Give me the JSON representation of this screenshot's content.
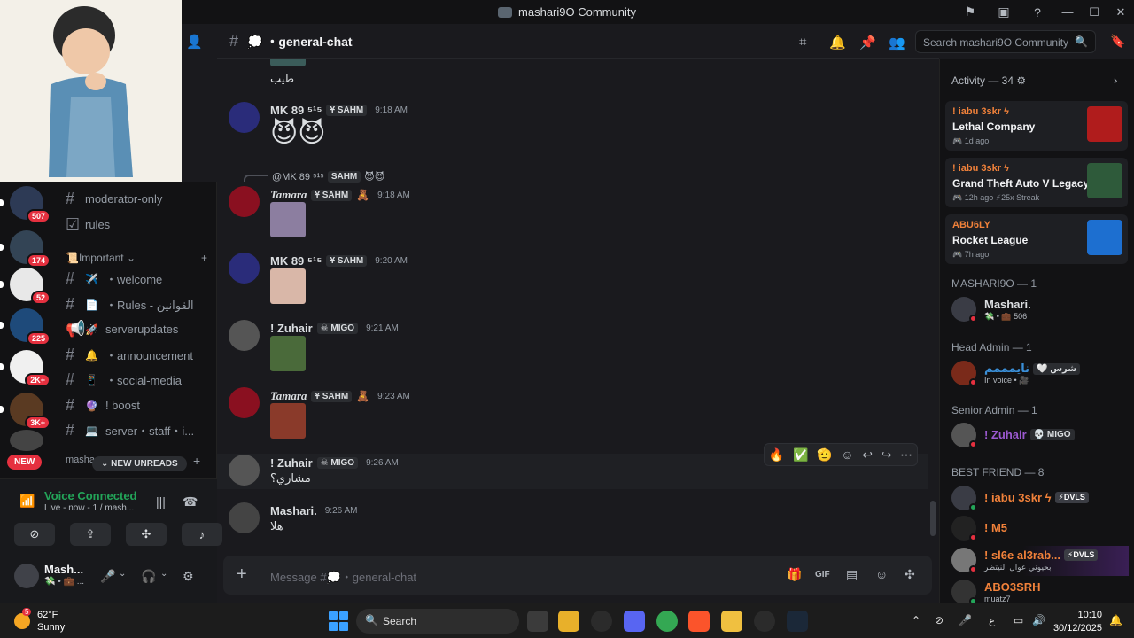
{
  "window": {
    "title": "mashari9O Community",
    "icons": [
      "flag-icon",
      "inbox-box-icon",
      "help-icon"
    ],
    "controls": [
      "—",
      "☐",
      "✕"
    ]
  },
  "rail": {
    "servers": [
      {
        "badge": "507",
        "color": "#2d3a55"
      },
      {
        "badge": "174",
        "color": "#334455"
      },
      {
        "badge": "52",
        "color": "#e8e8e8"
      },
      {
        "badge": "225",
        "color": "#1e4a7a"
      },
      {
        "badge": "2K+",
        "color": "#f0f0f0"
      },
      {
        "badge": "3K+",
        "color": "#5a3a22"
      },
      {
        "badge": "",
        "color": "#444"
      }
    ],
    "new_label": "NEW"
  },
  "channels": {
    "items_top": [
      {
        "name": "moderator-only",
        "icon": "#"
      },
      {
        "name": "rules",
        "icon": "☑"
      }
    ],
    "category": "Important",
    "category_prefix": "📜",
    "items": [
      {
        "name": "・welcome",
        "emoji": "✈️",
        "icon": "#"
      },
      {
        "name": "・Rules - القوانين",
        "emoji": "📄",
        "icon": "#"
      },
      {
        "name": "serverupdates",
        "emoji": "🚀",
        "icon": "📢"
      },
      {
        "name": "・announcement",
        "emoji": "🔔",
        "icon": "#"
      },
      {
        "name": "・social-media",
        "emoji": "📱",
        "icon": "#"
      },
      {
        "name": "! boost",
        "emoji": "🔮",
        "icon": "#"
      },
      {
        "name": "server・staff・i...",
        "emoji": "💻",
        "icon": "#"
      }
    ],
    "partial_category": "masha",
    "new_unreads": "NEW UNREADS"
  },
  "voice": {
    "title": "Voice Connected",
    "subtitle": "Live - now - 1 / mash..."
  },
  "user": {
    "name": "Mash...",
    "status": "💸 • 💼 ..."
  },
  "header": {
    "channel": "・general-chat",
    "channel_emoji": "💭",
    "search_placeholder": "Search mashari9O Community"
  },
  "messages": [
    {
      "body": "طيب"
    },
    {
      "author": "MK 89 ⁵¹⁵",
      "author_color": "#dbdee1",
      "tag": "SAHM",
      "time": "9:18 AM",
      "body": "😈😈"
    },
    {
      "reply_to": "@MK 89 ⁵¹⁵",
      "reply_tag": "SAHM",
      "reply_emoji": "😈😈",
      "author": "Tamara",
      "author_color": "#c0233a",
      "tag": "SAHM",
      "extra": "🧸",
      "time": "9:18 AM"
    },
    {
      "author": "MK 89 ⁵¹⁵",
      "author_color": "#dbdee1",
      "tag": "SAHM",
      "time": "9:20 AM"
    },
    {
      "author": "! Zuhair",
      "author_color": "#9b59d0",
      "tag": "MIGO",
      "time": "9:21 AM"
    },
    {
      "author": "Tamara",
      "author_color": "#c0233a",
      "tag": "SAHM",
      "extra": "🧸",
      "time": "9:23 AM"
    },
    {
      "author": "! Zuhair",
      "author_color": "#9b59d0",
      "tag": "MIGO",
      "time": "9:26 AM",
      "body": "مشاري؟"
    },
    {
      "author": "Mashari.",
      "author_color": "#dbdee1",
      "time": "9:26 AM",
      "body": "هلا"
    }
  ],
  "reactions": [
    "🔥",
    "✅",
    "🫡"
  ],
  "composer": {
    "placeholder": "Message #💭・general-chat"
  },
  "activity": {
    "header": "Activity — 34",
    "cards": [
      {
        "user": "! iabu 3skr ϟ",
        "game": "Lethal Company",
        "time": "1d ago",
        "color": "#b01c1c"
      },
      {
        "user": "! iabu 3skr ϟ",
        "game": "Grand Theft Auto V Legacy",
        "time": "12h ago",
        "streak": "25x Streak",
        "color": "#2e5a3a"
      },
      {
        "user": "ABU6LY",
        "game": "Rocket League",
        "time": "7h ago",
        "color": "#1d6fd0"
      }
    ]
  },
  "member_sections": [
    {
      "title": "MASHARI9O — 1",
      "members": [
        {
          "name": "Mashari.",
          "sub": "💸 • 💼 506",
          "color": "#dbdee1",
          "status": "#e5303f"
        }
      ]
    },
    {
      "title": "Head Admin — 1",
      "members": [
        {
          "name": "نايمممم",
          "badge": "🤍 شرس",
          "sub": "In voice • 🎥",
          "color": "#3a8fd8",
          "status": "#e5303f"
        }
      ]
    },
    {
      "title": "Senior Admin — 1",
      "members": [
        {
          "name": "! Zuhair",
          "badge": "💀 MIGO",
          "color": "#9b59d0",
          "status": "#e5303f"
        }
      ]
    },
    {
      "title": "BEST FRIEND — 8",
      "members": [
        {
          "name": "! iabu 3skr ϟ",
          "badge": "⚡DVLS",
          "color": "#f0813a",
          "status": "#23a559"
        },
        {
          "name": "! M5",
          "color": "#f0813a",
          "status": "#e5303f"
        },
        {
          "name": "! sl6e al3rab...",
          "badge": "⚡DVLS",
          "sub": "بحيوني عوال النيتظر",
          "color": "#f0813a",
          "status": "#e5303f"
        },
        {
          "name": "ABO3SRH",
          "sub": "muatz7",
          "color": "#f0813a",
          "status": "#23a559"
        }
      ]
    }
  ],
  "taskbar": {
    "temperature": "62°F",
    "condition": "Sunny",
    "weather_badge": "5",
    "search": "Search",
    "time": "10:10",
    "date": "30/12/2025",
    "lang": "ع"
  }
}
